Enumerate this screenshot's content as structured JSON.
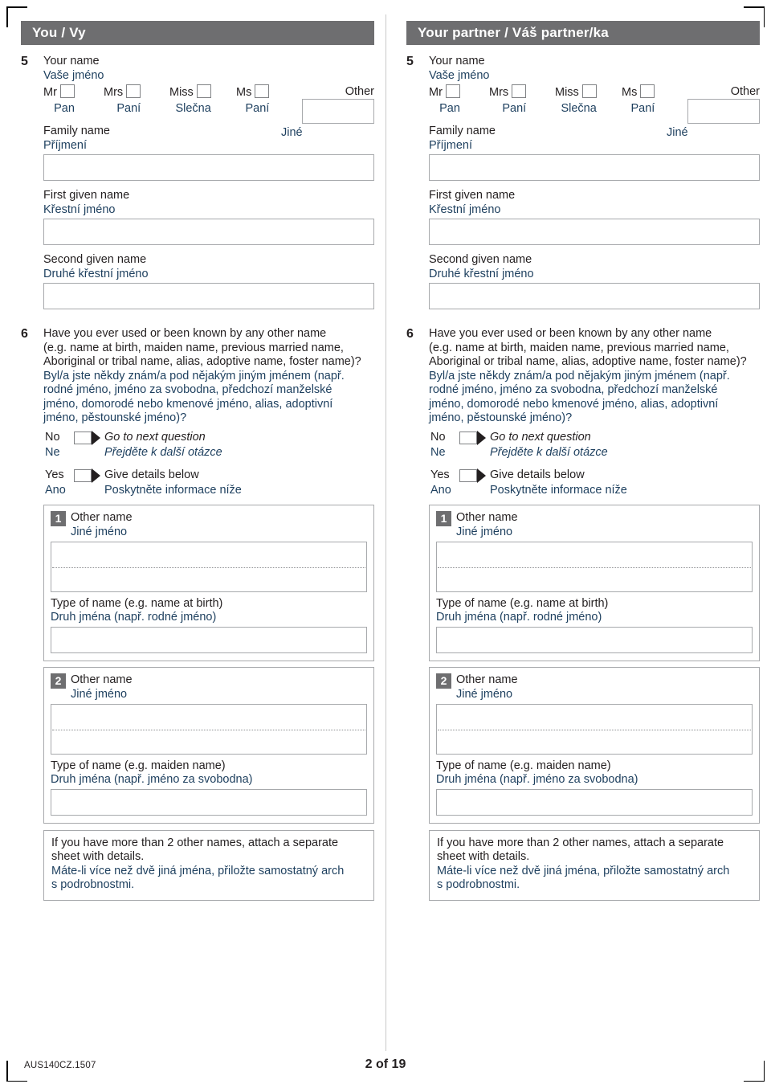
{
  "document": {
    "form_code": "AUS140CZ.1507",
    "page_label": "2 of 19"
  },
  "colors": {
    "banner_gray": "#6e6e70",
    "czech_blue": "#1d3f5e",
    "english_black": "#231f20",
    "field_border": "#a7a9ac"
  },
  "columns": [
    {
      "banner": "You / Vy",
      "q5": {
        "number": "5",
        "title_en": "Your name",
        "title_cz": "Vaše jméno",
        "titles": [
          {
            "en": "Mr",
            "cz": "Pan"
          },
          {
            "en": "Mrs",
            "cz": "Paní"
          },
          {
            "en": "Miss",
            "cz": "Slečna"
          },
          {
            "en": "Ms",
            "cz": "Paní"
          },
          {
            "en": "Other",
            "cz": "Jiné"
          }
        ],
        "other_value": "",
        "family_en": "Family name",
        "family_cz": "Příjmení",
        "family_value": "",
        "first_en": "First given name",
        "first_cz": "Křestní jméno",
        "first_value": "",
        "second_en": "Second given name",
        "second_cz": "Druhé křestní jméno",
        "second_value": ""
      },
      "q6": {
        "number": "6",
        "question_en": "Have you ever used or been known by any other name (e.g. name at birth, maiden name, previous married name, Aboriginal or tribal name, alias, adoptive name, foster name)?",
        "question_en_lines": [
          "Have you ever used or been known by any other name",
          "(e.g. name at birth, maiden name, previous married name,",
          "Aboriginal or tribal name, alias, adoptive name, foster name)?"
        ],
        "question_cz_lines": [
          "Byl/a jste někdy znám/a pod nějakým jiným jménem (např.",
          "rodné jméno, jméno za svobodna, předchozí manželské",
          "jméno, domorodé nebo kmenové jméno, alias, adoptivní",
          "jméno, pěstounské jméno)?"
        ],
        "no_en": "No",
        "no_cz": "Ne",
        "no_action_en": "Go to next question",
        "no_action_cz": "Přejděte k další otázce",
        "yes_en": "Yes",
        "yes_cz": "Ano",
        "yes_action_en": "Give details below",
        "yes_action_cz": "Poskytněte informace níže",
        "other_names": [
          {
            "badge": "1",
            "label_en": "Other name",
            "label_cz": "Jiné jméno",
            "name_value": "",
            "type_en": "Type of name (e.g. name at birth)",
            "type_cz": "Druh jména (např. rodné jméno)",
            "type_value": ""
          },
          {
            "badge": "2",
            "label_en": "Other name",
            "label_cz": "Jiné jméno",
            "name_value": "",
            "type_en": "Type of name (e.g. maiden name)",
            "type_cz": "Druh jména (např. jméno za svobodna)",
            "type_value": ""
          }
        ],
        "note_en_lines": [
          "If you have more than 2 other names, attach a separate",
          "sheet with details."
        ],
        "note_cz_lines": [
          "Máte-li více než dvě jiná jména, přiložte samostatný arch",
          "s podrobnostmi."
        ]
      }
    },
    {
      "banner": "Your partner / Váš partner/ka",
      "q5": {
        "number": "5",
        "title_en": "Your name",
        "title_cz": "Vaše jméno",
        "titles": [
          {
            "en": "Mr",
            "cz": "Pan"
          },
          {
            "en": "Mrs",
            "cz": "Paní"
          },
          {
            "en": "Miss",
            "cz": "Slečna"
          },
          {
            "en": "Ms",
            "cz": "Paní"
          },
          {
            "en": "Other",
            "cz": "Jiné"
          }
        ],
        "other_value": "",
        "family_en": "Family name",
        "family_cz": "Příjmení",
        "family_value": "",
        "first_en": "First given name",
        "first_cz": "Křestní jméno",
        "first_value": "",
        "second_en": "Second given name",
        "second_cz": "Druhé křestní jméno",
        "second_value": ""
      },
      "q6": {
        "number": "6",
        "question_en": "Have you ever used or been known by any other name (e.g. name at birth, maiden name, previous married name, Aboriginal or tribal name, alias, adoptive name, foster name)?",
        "question_en_lines": [
          "Have you ever used or been known by any other name",
          "(e.g. name at birth, maiden name, previous married name,",
          "Aboriginal or tribal name, alias, adoptive name, foster name)?"
        ],
        "question_cz_lines": [
          "Byl/a jste někdy znám/a pod nějakým jiným jménem (např.",
          "rodné jméno, jméno za svobodna, předchozí manželské",
          "jméno, domorodé nebo kmenové jméno, alias, adoptivní",
          "jméno, pěstounské jméno)?"
        ],
        "no_en": "No",
        "no_cz": "Ne",
        "no_action_en": "Go to next question",
        "no_action_cz": "Přejděte k další otázce",
        "yes_en": "Yes",
        "yes_cz": "Ano",
        "yes_action_en": "Give details below",
        "yes_action_cz": "Poskytněte informace níže",
        "other_names": [
          {
            "badge": "1",
            "label_en": "Other name",
            "label_cz": "Jiné jméno",
            "name_value": "",
            "type_en": "Type of name (e.g. name at birth)",
            "type_cz": "Druh jména (např. rodné jméno)",
            "type_value": ""
          },
          {
            "badge": "2",
            "label_en": "Other name",
            "label_cz": "Jiné jméno",
            "name_value": "",
            "type_en": "Type of name (e.g. maiden name)",
            "type_cz": "Druh jména (např. jméno za svobodna)",
            "type_value": ""
          }
        ],
        "note_en_lines": [
          "If you have more than 2 other names, attach a separate",
          "sheet with details."
        ],
        "note_cz_lines": [
          "Máte-li více než dvě jiná jména, přiložte samostatný arch",
          "s podrobnostmi."
        ]
      }
    }
  ]
}
